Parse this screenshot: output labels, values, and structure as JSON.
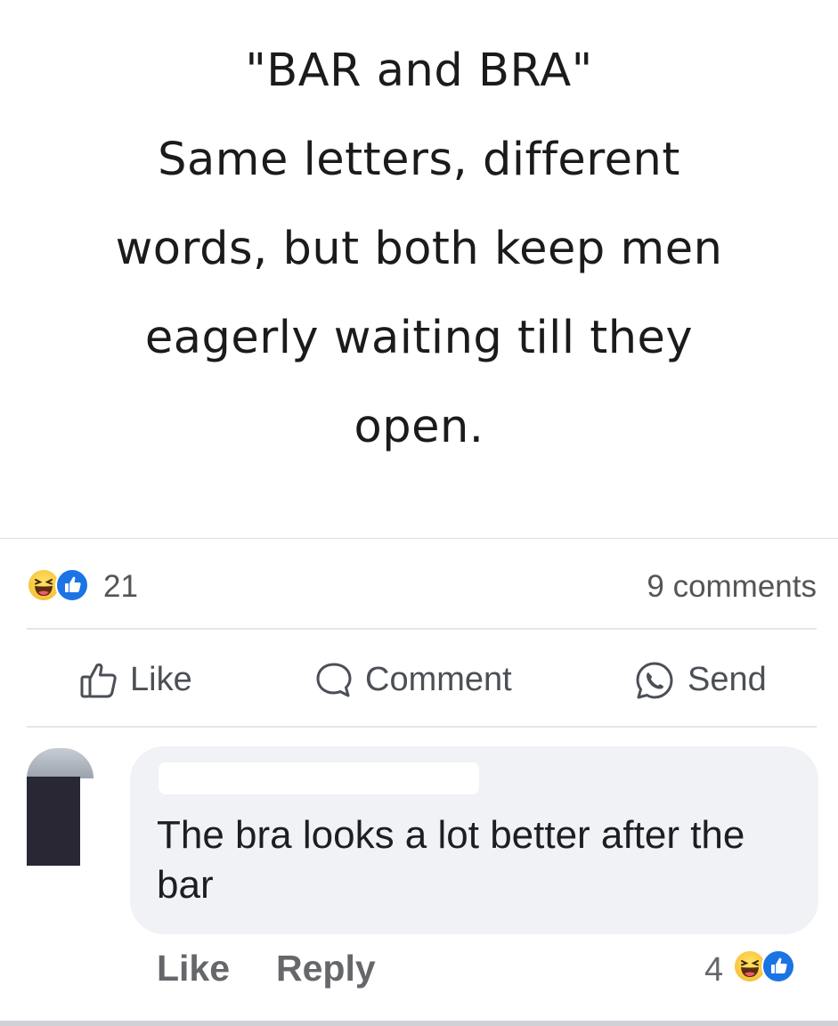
{
  "post": {
    "quote_lines": [
      "\"BAR and BRA\"",
      "Same letters, different",
      "words, but both keep men",
      "eagerly waiting till they",
      "open."
    ]
  },
  "summary": {
    "reaction_count": "21",
    "reaction_icons": [
      "haha-icon",
      "like-icon"
    ],
    "comments_label": "9 comments"
  },
  "actions": {
    "like_label": "Like",
    "comment_label": "Comment",
    "send_label": "Send"
  },
  "comment": {
    "text": "The bra looks a lot better after the bar",
    "like_label": "Like",
    "reply_label": "Reply",
    "reaction_count": "4",
    "reaction_icons": [
      "haha-icon",
      "like-icon"
    ]
  },
  "colors": {
    "like_blue": "#1b74e4",
    "haha_yellow": "#f7c43b",
    "bubble_bg": "#f0f2f5",
    "muted_text": "#65676b"
  }
}
